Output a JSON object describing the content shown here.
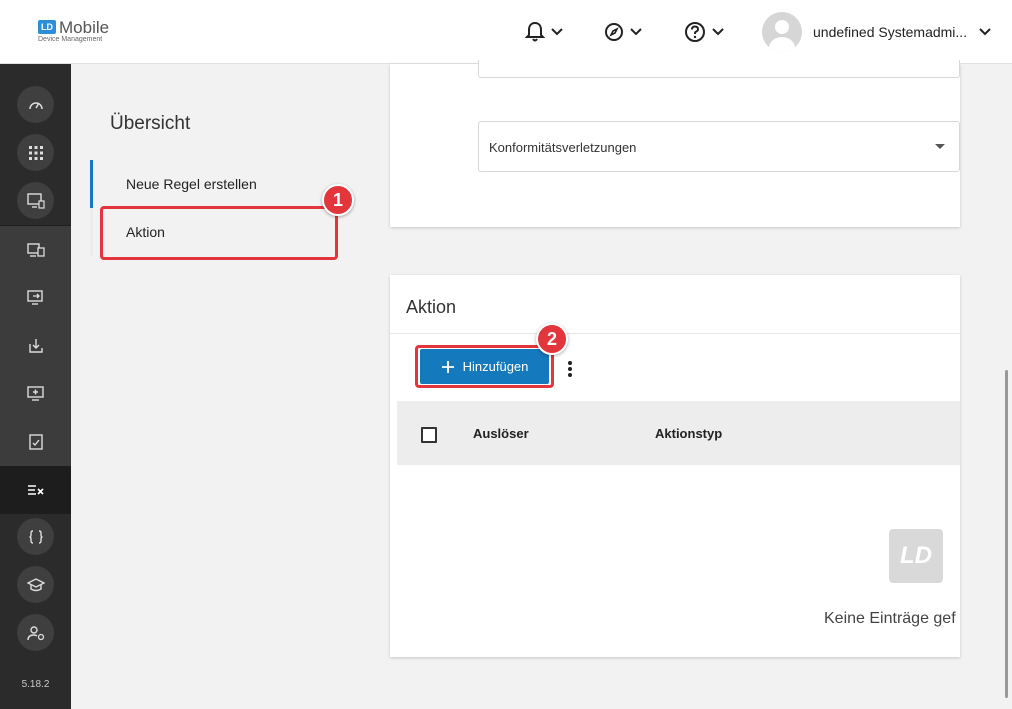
{
  "header": {
    "logo_badge": "LD",
    "logo_title": "Mobile",
    "logo_subtitle": "Device Management",
    "notifications_icon": "bell-icon",
    "explore_icon": "compass-icon",
    "help_icon": "help-icon",
    "user_name": "undefined Systemadmi..."
  },
  "sidebar": {
    "icons": [
      "dashboard-icon",
      "apps-icon",
      "device-settings-icon",
      "devices-icon",
      "screen-arrow-icon",
      "download-icon",
      "screen-add-icon",
      "checklist-icon",
      "compliance-icon",
      "braces-icon",
      "graduation-icon",
      "user-settings-icon"
    ],
    "version": "5.18.2"
  },
  "overview": {
    "title": "Übersicht",
    "items": [
      {
        "label": "Neue Regel erstellen"
      },
      {
        "label": "Aktion"
      }
    ]
  },
  "callouts": {
    "one": "1",
    "two": "2"
  },
  "top_card": {
    "select_value": "Konformitätsverletzungen"
  },
  "action_card": {
    "title": "Aktion",
    "add_button": "Hinzufügen",
    "columns": [
      "Auslöser",
      "Aktionstyp"
    ],
    "empty_logo": "LD",
    "empty_text": "Keine Einträge gef"
  },
  "colors": {
    "accent": "#1579be",
    "callout": "#e2363c",
    "sidebar": "#2b2b2b"
  }
}
